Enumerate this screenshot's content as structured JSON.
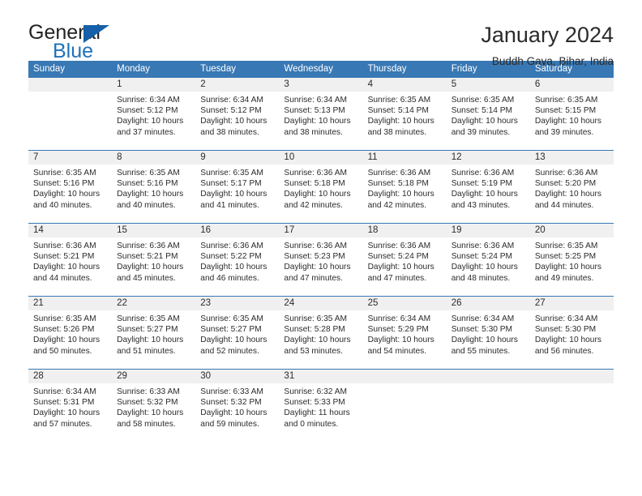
{
  "logo": {
    "word1": "General",
    "word2": "Blue",
    "triangle_color": "#1560a8",
    "blue_color": "#1f72b8"
  },
  "header": {
    "title": "January 2024",
    "subtitle": "Buddh Gaya, Bihar, India"
  },
  "theme": {
    "header_blue": "#3878b4",
    "band_gray": "#f0f0f0",
    "text": "#2b2b2b"
  },
  "weekdays": [
    "Sunday",
    "Monday",
    "Tuesday",
    "Wednesday",
    "Thursday",
    "Friday",
    "Saturday"
  ],
  "labels": {
    "sunrise_prefix": "Sunrise:",
    "sunset_prefix": "Sunset:",
    "daylight_prefix": "Daylight:"
  },
  "weeks": [
    [
      {
        "day": ""
      },
      {
        "day": "1",
        "sunrise": "Sunrise: 6:34 AM",
        "sunset": "Sunset: 5:12 PM",
        "daylight1": "Daylight: 10 hours",
        "daylight2": "and 37 minutes."
      },
      {
        "day": "2",
        "sunrise": "Sunrise: 6:34 AM",
        "sunset": "Sunset: 5:12 PM",
        "daylight1": "Daylight: 10 hours",
        "daylight2": "and 38 minutes."
      },
      {
        "day": "3",
        "sunrise": "Sunrise: 6:34 AM",
        "sunset": "Sunset: 5:13 PM",
        "daylight1": "Daylight: 10 hours",
        "daylight2": "and 38 minutes."
      },
      {
        "day": "4",
        "sunrise": "Sunrise: 6:35 AM",
        "sunset": "Sunset: 5:14 PM",
        "daylight1": "Daylight: 10 hours",
        "daylight2": "and 38 minutes."
      },
      {
        "day": "5",
        "sunrise": "Sunrise: 6:35 AM",
        "sunset": "Sunset: 5:14 PM",
        "daylight1": "Daylight: 10 hours",
        "daylight2": "and 39 minutes."
      },
      {
        "day": "6",
        "sunrise": "Sunrise: 6:35 AM",
        "sunset": "Sunset: 5:15 PM",
        "daylight1": "Daylight: 10 hours",
        "daylight2": "and 39 minutes."
      }
    ],
    [
      {
        "day": "7",
        "sunrise": "Sunrise: 6:35 AM",
        "sunset": "Sunset: 5:16 PM",
        "daylight1": "Daylight: 10 hours",
        "daylight2": "and 40 minutes."
      },
      {
        "day": "8",
        "sunrise": "Sunrise: 6:35 AM",
        "sunset": "Sunset: 5:16 PM",
        "daylight1": "Daylight: 10 hours",
        "daylight2": "and 40 minutes."
      },
      {
        "day": "9",
        "sunrise": "Sunrise: 6:35 AM",
        "sunset": "Sunset: 5:17 PM",
        "daylight1": "Daylight: 10 hours",
        "daylight2": "and 41 minutes."
      },
      {
        "day": "10",
        "sunrise": "Sunrise: 6:36 AM",
        "sunset": "Sunset: 5:18 PM",
        "daylight1": "Daylight: 10 hours",
        "daylight2": "and 42 minutes."
      },
      {
        "day": "11",
        "sunrise": "Sunrise: 6:36 AM",
        "sunset": "Sunset: 5:18 PM",
        "daylight1": "Daylight: 10 hours",
        "daylight2": "and 42 minutes."
      },
      {
        "day": "12",
        "sunrise": "Sunrise: 6:36 AM",
        "sunset": "Sunset: 5:19 PM",
        "daylight1": "Daylight: 10 hours",
        "daylight2": "and 43 minutes."
      },
      {
        "day": "13",
        "sunrise": "Sunrise: 6:36 AM",
        "sunset": "Sunset: 5:20 PM",
        "daylight1": "Daylight: 10 hours",
        "daylight2": "and 44 minutes."
      }
    ],
    [
      {
        "day": "14",
        "sunrise": "Sunrise: 6:36 AM",
        "sunset": "Sunset: 5:21 PM",
        "daylight1": "Daylight: 10 hours",
        "daylight2": "and 44 minutes."
      },
      {
        "day": "15",
        "sunrise": "Sunrise: 6:36 AM",
        "sunset": "Sunset: 5:21 PM",
        "daylight1": "Daylight: 10 hours",
        "daylight2": "and 45 minutes."
      },
      {
        "day": "16",
        "sunrise": "Sunrise: 6:36 AM",
        "sunset": "Sunset: 5:22 PM",
        "daylight1": "Daylight: 10 hours",
        "daylight2": "and 46 minutes."
      },
      {
        "day": "17",
        "sunrise": "Sunrise: 6:36 AM",
        "sunset": "Sunset: 5:23 PM",
        "daylight1": "Daylight: 10 hours",
        "daylight2": "and 47 minutes."
      },
      {
        "day": "18",
        "sunrise": "Sunrise: 6:36 AM",
        "sunset": "Sunset: 5:24 PM",
        "daylight1": "Daylight: 10 hours",
        "daylight2": "and 47 minutes."
      },
      {
        "day": "19",
        "sunrise": "Sunrise: 6:36 AM",
        "sunset": "Sunset: 5:24 PM",
        "daylight1": "Daylight: 10 hours",
        "daylight2": "and 48 minutes."
      },
      {
        "day": "20",
        "sunrise": "Sunrise: 6:35 AM",
        "sunset": "Sunset: 5:25 PM",
        "daylight1": "Daylight: 10 hours",
        "daylight2": "and 49 minutes."
      }
    ],
    [
      {
        "day": "21",
        "sunrise": "Sunrise: 6:35 AM",
        "sunset": "Sunset: 5:26 PM",
        "daylight1": "Daylight: 10 hours",
        "daylight2": "and 50 minutes."
      },
      {
        "day": "22",
        "sunrise": "Sunrise: 6:35 AM",
        "sunset": "Sunset: 5:27 PM",
        "daylight1": "Daylight: 10 hours",
        "daylight2": "and 51 minutes."
      },
      {
        "day": "23",
        "sunrise": "Sunrise: 6:35 AM",
        "sunset": "Sunset: 5:27 PM",
        "daylight1": "Daylight: 10 hours",
        "daylight2": "and 52 minutes."
      },
      {
        "day": "24",
        "sunrise": "Sunrise: 6:35 AM",
        "sunset": "Sunset: 5:28 PM",
        "daylight1": "Daylight: 10 hours",
        "daylight2": "and 53 minutes."
      },
      {
        "day": "25",
        "sunrise": "Sunrise: 6:34 AM",
        "sunset": "Sunset: 5:29 PM",
        "daylight1": "Daylight: 10 hours",
        "daylight2": "and 54 minutes."
      },
      {
        "day": "26",
        "sunrise": "Sunrise: 6:34 AM",
        "sunset": "Sunset: 5:30 PM",
        "daylight1": "Daylight: 10 hours",
        "daylight2": "and 55 minutes."
      },
      {
        "day": "27",
        "sunrise": "Sunrise: 6:34 AM",
        "sunset": "Sunset: 5:30 PM",
        "daylight1": "Daylight: 10 hours",
        "daylight2": "and 56 minutes."
      }
    ],
    [
      {
        "day": "28",
        "sunrise": "Sunrise: 6:34 AM",
        "sunset": "Sunset: 5:31 PM",
        "daylight1": "Daylight: 10 hours",
        "daylight2": "and 57 minutes."
      },
      {
        "day": "29",
        "sunrise": "Sunrise: 6:33 AM",
        "sunset": "Sunset: 5:32 PM",
        "daylight1": "Daylight: 10 hours",
        "daylight2": "and 58 minutes."
      },
      {
        "day": "30",
        "sunrise": "Sunrise: 6:33 AM",
        "sunset": "Sunset: 5:32 PM",
        "daylight1": "Daylight: 10 hours",
        "daylight2": "and 59 minutes."
      },
      {
        "day": "31",
        "sunrise": "Sunrise: 6:32 AM",
        "sunset": "Sunset: 5:33 PM",
        "daylight1": "Daylight: 11 hours",
        "daylight2": "and 0 minutes."
      },
      {
        "day": ""
      },
      {
        "day": ""
      },
      {
        "day": ""
      }
    ]
  ]
}
